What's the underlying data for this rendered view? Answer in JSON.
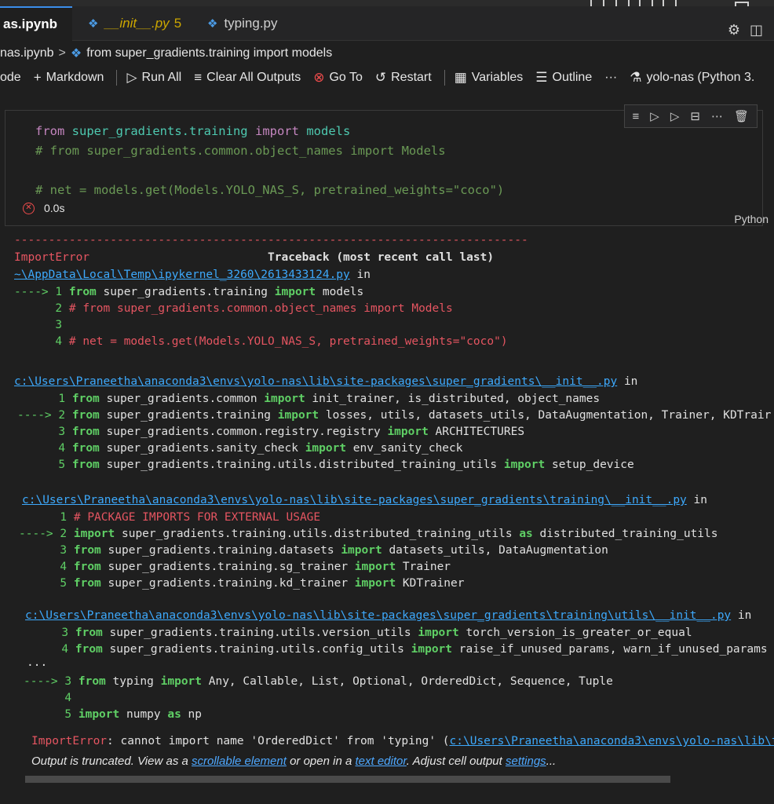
{
  "tabs": [
    {
      "label": "as.ipynb",
      "active": true,
      "modified": true
    },
    {
      "label": "__init__.py",
      "count": "5"
    },
    {
      "label": "typing.py"
    }
  ],
  "breadcrumb": {
    "file": "nas.ipynb",
    "symbol": "from super_gradients.training import models"
  },
  "toolbar": {
    "code_label": "ode",
    "markdown_label": "Markdown",
    "run_all_label": "Run All",
    "clear_outputs_label": "Clear All Outputs",
    "goto_label": "Go To",
    "restart_label": "Restart",
    "variables_label": "Variables",
    "outline_label": "Outline",
    "more_label": "···",
    "kernel_label": "yolo-nas (Python 3."
  },
  "cell": {
    "code": {
      "line1_kw_from": "from",
      "line1_mod": "super_gradients.training",
      "line1_kw_import": "import",
      "line1_name": "models",
      "line2": "# from super_gradients.common.object_names import Models",
      "line4": "# net = models.get(Models.YOLO_NAS_S, pretrained_weights=\"coco\")"
    },
    "status_time": "0.0s",
    "language": "Python"
  },
  "output": {
    "dashes": "---------------------------------------------------------------------------",
    "error_name": "ImportError",
    "traceback_header": "Traceback (most recent call last)",
    "frame1_path": "~\\AppData\\Local\\Temp\\ipykernel_3260\\2613433124.py",
    "frame1_in": " in",
    "frame1_lines": [
      {
        "arrow": "----> ",
        "num": "1",
        "kw1": "from",
        "rest1": " super_gradients.training ",
        "kw2": "import",
        "rest2": " models"
      },
      {
        "arrow": "      ",
        "num": "2",
        "comment": "# from super_gradients.common.object_names import Models"
      },
      {
        "arrow": "      ",
        "num": "3"
      },
      {
        "arrow": "      ",
        "num": "4",
        "comment": "# net = models.get(Models.YOLO_NAS_S, pretrained_weights=\"coco\")"
      }
    ],
    "frame2_path": "c:\\Users\\Praneetha\\anaconda3\\envs\\yolo-nas\\lib\\site-packages\\super_gradients\\__init__.py",
    "frame2_lines": [
      {
        "arrow": "      ",
        "num": "1",
        "kw1": "from",
        "rest1": " super_gradients.common ",
        "kw2": "import",
        "rest2": " init_trainer, is_distributed, object_names"
      },
      {
        "arrow": "----> ",
        "num": "2",
        "kw1": "from",
        "rest1": " super_gradients.training ",
        "kw2": "import",
        "rest2": " losses, utils, datasets_utils, DataAugmentation, Trainer, KDTrair"
      },
      {
        "arrow": "      ",
        "num": "3",
        "kw1": "from",
        "rest1": " super_gradients.common.registry.registry ",
        "kw2": "import",
        "rest2": " ARCHITECTURES"
      },
      {
        "arrow": "      ",
        "num": "4",
        "kw1": "from",
        "rest1": " super_gradients.sanity_check ",
        "kw2": "import",
        "rest2": " env_sanity_check"
      },
      {
        "arrow": "      ",
        "num": "5",
        "kw1": "from",
        "rest1": " super_gradients.training.utils.distributed_training_utils ",
        "kw2": "import",
        "rest2": " setup_device"
      }
    ],
    "frame3_path": "c:\\Users\\Praneetha\\anaconda3\\envs\\yolo-nas\\lib\\site-packages\\super_gradients\\training\\__init__.py",
    "frame3_lines": [
      {
        "arrow": "      ",
        "num": "1",
        "comment": "# PACKAGE IMPORTS FOR EXTERNAL USAGE"
      },
      {
        "arrow": "----> ",
        "num": "2",
        "kw1": "import",
        "rest1": " super_gradients.training.utils.distributed_training_utils ",
        "kw2": "as",
        "rest2": " distributed_training_utils"
      },
      {
        "arrow": "      ",
        "num": "3",
        "kw1": "from",
        "rest1": " super_gradients.training.datasets ",
        "kw2": "import",
        "rest2": " datasets_utils, DataAugmentation"
      },
      {
        "arrow": "      ",
        "num": "4",
        "kw1": "from",
        "rest1": " super_gradients.training.sg_trainer ",
        "kw2": "import",
        "rest2": " Trainer"
      },
      {
        "arrow": "      ",
        "num": "5",
        "kw1": "from",
        "rest1": " super_gradients.training.kd_trainer ",
        "kw2": "import",
        "rest2": " KDTrainer"
      }
    ],
    "frame4_path": "c:\\Users\\Praneetha\\anaconda3\\envs\\yolo-nas\\lib\\site-packages\\super_gradients\\training\\utils\\__init__.py",
    "frame4_lines": [
      {
        "arrow": "      ",
        "num": "3",
        "kw1": "from",
        "rest1": " super_gradients.training.utils.version_utils ",
        "kw2": "import",
        "rest2": " torch_version_is_greater_or_equal"
      },
      {
        "arrow": "      ",
        "num": "4",
        "kw1": "from",
        "rest1": " super_gradients.training.utils.config_utils ",
        "kw2": "import",
        "rest2": " raise_if_unused_params, warn_if_unused_params"
      }
    ],
    "ellipsis": "...",
    "frame5_lines": [
      {
        "arrow": "----> ",
        "num": "3",
        "kw1": "from",
        "rest1": " typing ",
        "kw2": "import",
        "rest2": " Any, Callable, List, Optional, OrderedDict, Sequence, Tuple"
      },
      {
        "arrow": "      ",
        "num": "4"
      },
      {
        "arrow": "      ",
        "num": "5",
        "kw1": "import",
        "rest1": " numpy ",
        "kw2": "as",
        "rest2": " np"
      }
    ],
    "final_error_name": "ImportError",
    "final_error_msg": ": cannot import name 'OrderedDict' from 'typing' (",
    "final_error_path": "c:\\Users\\Praneetha\\anaconda3\\envs\\yolo-nas\\lib\\ty",
    "truncated": {
      "prefix": "Output is truncated. View as a ",
      "scrollable": "scrollable element",
      "middle": " or open in a ",
      "editor": "text editor",
      "suffix": ". Adjust cell output ",
      "settings": "settings",
      "end": "..."
    }
  }
}
